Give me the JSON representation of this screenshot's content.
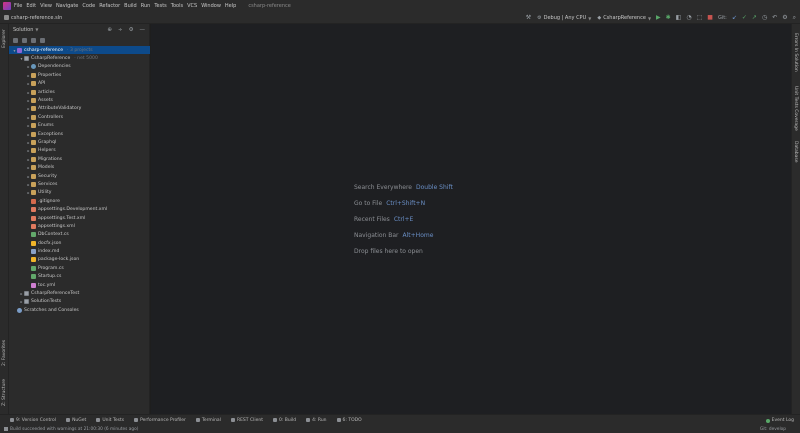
{
  "menu": {
    "items": [
      "File",
      "Edit",
      "View",
      "Navigate",
      "Code",
      "Refactor",
      "Build",
      "Run",
      "Tests",
      "Tools",
      "VCS",
      "Window",
      "Help"
    ],
    "window_title": "csharp-reference"
  },
  "nav": {
    "breadcrumb": "csharp-reference.sln",
    "config": "Debug | Any CPU",
    "run_config": "CsharpReference",
    "git_label": "Git:"
  },
  "left_strip": {
    "explorer": "Explorer",
    "favorites": "2: Favorites",
    "structure": "Z: Structure"
  },
  "right_strip": {
    "errors": "Errors In Solution",
    "coverage": "Unit Tests Coverage",
    "database": "Database"
  },
  "panel": {
    "title": "Solution"
  },
  "tree": [
    {
      "depth": 0,
      "toggle": "▾",
      "icon": "sol",
      "label": "csharp-reference",
      "sub": "· 3 projects",
      "selected": true
    },
    {
      "depth": 1,
      "toggle": "▾",
      "icon": "proj",
      "label": "CsharpReference",
      "sub": "· net 5000",
      "selected": false
    },
    {
      "depth": 2,
      "toggle": "▸",
      "icon": "dep",
      "label": "Dependencies",
      "sub": "",
      "selected": false
    },
    {
      "depth": 2,
      "toggle": "▸",
      "icon": "folder",
      "label": "Properties",
      "sub": "",
      "selected": false
    },
    {
      "depth": 2,
      "toggle": "▸",
      "icon": "folder",
      "label": "API",
      "sub": "",
      "selected": false
    },
    {
      "depth": 2,
      "toggle": "▸",
      "icon": "folder",
      "label": "articles",
      "sub": "",
      "selected": false
    },
    {
      "depth": 2,
      "toggle": "▸",
      "icon": "folder",
      "label": "Assets",
      "sub": "",
      "selected": false
    },
    {
      "depth": 2,
      "toggle": "▸",
      "icon": "folder",
      "label": "AttributeValidatory",
      "sub": "",
      "selected": false
    },
    {
      "depth": 2,
      "toggle": "▸",
      "icon": "folder",
      "label": "Controllers",
      "sub": "",
      "selected": false
    },
    {
      "depth": 2,
      "toggle": "▸",
      "icon": "folder",
      "label": "Enums",
      "sub": "",
      "selected": false
    },
    {
      "depth": 2,
      "toggle": "▸",
      "icon": "folder",
      "label": "Exceptions",
      "sub": "",
      "selected": false
    },
    {
      "depth": 2,
      "toggle": "▸",
      "icon": "folder",
      "label": "Graphql",
      "sub": "",
      "selected": false
    },
    {
      "depth": 2,
      "toggle": "▸",
      "icon": "folder",
      "label": "Helpers",
      "sub": "",
      "selected": false
    },
    {
      "depth": 2,
      "toggle": "▸",
      "icon": "folder",
      "label": "Migrations",
      "sub": "",
      "selected": false
    },
    {
      "depth": 2,
      "toggle": "▸",
      "icon": "folder",
      "label": "Models",
      "sub": "",
      "selected": false
    },
    {
      "depth": 2,
      "toggle": "▸",
      "icon": "folder",
      "label": "Security",
      "sub": "",
      "selected": false
    },
    {
      "depth": 2,
      "toggle": "▸",
      "icon": "folder",
      "label": "Services",
      "sub": "",
      "selected": false
    },
    {
      "depth": 2,
      "toggle": "▸",
      "icon": "folder",
      "label": "Utility",
      "sub": "",
      "selected": false
    },
    {
      "depth": 2,
      "toggle": "",
      "icon": "git",
      "label": ".gitignore",
      "sub": "",
      "selected": false
    },
    {
      "depth": 2,
      "toggle": "",
      "icon": "xml",
      "label": "appsettings.Development.xml",
      "sub": "",
      "selected": false
    },
    {
      "depth": 2,
      "toggle": "",
      "icon": "xml",
      "label": "appsettings.Test.xml",
      "sub": "",
      "selected": false
    },
    {
      "depth": 2,
      "toggle": "",
      "icon": "xml",
      "label": "appsettings.xml",
      "sub": "",
      "selected": false
    },
    {
      "depth": 2,
      "toggle": "",
      "icon": "cs",
      "label": "DbContext.cs",
      "sub": "",
      "selected": false
    },
    {
      "depth": 2,
      "toggle": "",
      "icon": "json",
      "label": "docfx.json",
      "sub": "",
      "selected": false
    },
    {
      "depth": 2,
      "toggle": "",
      "icon": "md",
      "label": "index.md",
      "sub": "",
      "selected": false
    },
    {
      "depth": 2,
      "toggle": "",
      "icon": "json",
      "label": "package-lock.json",
      "sub": "",
      "selected": false
    },
    {
      "depth": 2,
      "toggle": "",
      "icon": "cs",
      "label": "Program.cs",
      "sub": "",
      "selected": false
    },
    {
      "depth": 2,
      "toggle": "",
      "icon": "cs",
      "label": "Startup.cs",
      "sub": "",
      "selected": false
    },
    {
      "depth": 2,
      "toggle": "",
      "icon": "yml",
      "label": "toc.yml",
      "sub": "",
      "selected": false
    },
    {
      "depth": 1,
      "toggle": "▸",
      "icon": "proj",
      "label": "CsharpReferenceTest",
      "sub": "",
      "selected": false
    },
    {
      "depth": 1,
      "toggle": "▸",
      "icon": "proj",
      "label": "SolutionTests",
      "sub": "",
      "selected": false
    },
    {
      "depth": 0,
      "toggle": "",
      "icon": "scratch",
      "label": "Scratches and Consoles",
      "sub": "",
      "selected": false
    }
  ],
  "editor": {
    "hints": [
      {
        "label": "Search Everywhere",
        "key": "Double Shift"
      },
      {
        "label": "Go to File",
        "key": "Ctrl+Shift+N"
      },
      {
        "label": "Recent Files",
        "key": "Ctrl+E"
      },
      {
        "label": "Navigation Bar",
        "key": "Alt+Home"
      },
      {
        "label": "Drop files here to open",
        "key": ""
      }
    ]
  },
  "bottom_tabs": [
    "9: Version Control",
    "NuGet",
    "Unit Tests",
    "Performance Profiler",
    "Terminal",
    "REST Client",
    "0: Build",
    "4: Run",
    "6: TODO"
  ],
  "bottom_right": "Event Log",
  "status": {
    "message": "Build succeeded with warnings at 21:00:30 (6 minutes ago)",
    "git_branch": "Git: develop"
  },
  "colors": {
    "selection": "#0d4a8a",
    "accent_key": "#6a8fc6",
    "run": "#59a869"
  }
}
